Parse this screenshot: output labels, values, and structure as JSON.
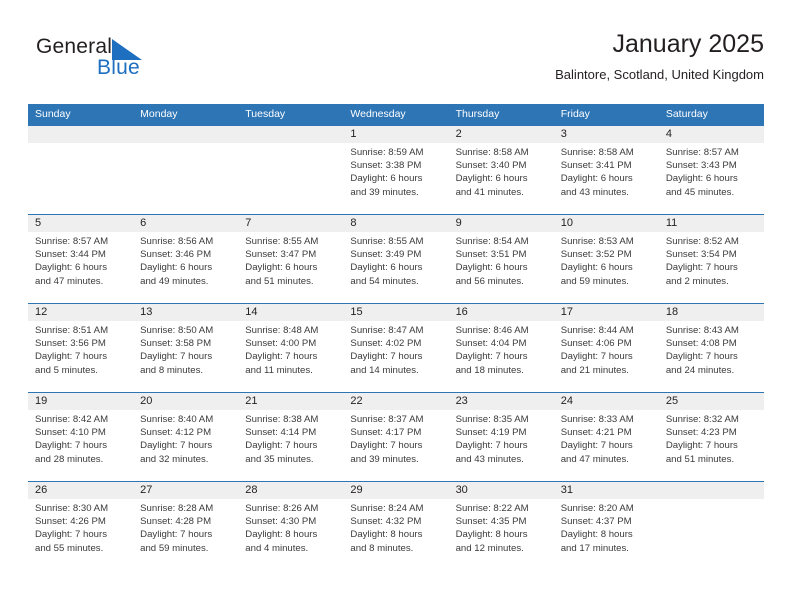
{
  "brand": {
    "word_general": "General",
    "word_blue": "Blue",
    "triangle_icon": "triangle-icon",
    "accent_color": "#1f6fc0"
  },
  "header": {
    "title": "January 2025",
    "subtitle": "Balintore, Scotland, United Kingdom",
    "header_bg_color": "#2e75b6",
    "day_band_color": "#efefef"
  },
  "weekdays": [
    "Sunday",
    "Monday",
    "Tuesday",
    "Wednesday",
    "Thursday",
    "Friday",
    "Saturday"
  ],
  "weeks": [
    [
      {
        "number": "",
        "sunrise": "",
        "sunset": "",
        "daylight_line1": "",
        "daylight_line2": ""
      },
      {
        "number": "",
        "sunrise": "",
        "sunset": "",
        "daylight_line1": "",
        "daylight_line2": ""
      },
      {
        "number": "",
        "sunrise": "",
        "sunset": "",
        "daylight_line1": "",
        "daylight_line2": ""
      },
      {
        "number": "1",
        "sunrise": "Sunrise: 8:59 AM",
        "sunset": "Sunset: 3:38 PM",
        "daylight_line1": "Daylight: 6 hours",
        "daylight_line2": "and 39 minutes."
      },
      {
        "number": "2",
        "sunrise": "Sunrise: 8:58 AM",
        "sunset": "Sunset: 3:40 PM",
        "daylight_line1": "Daylight: 6 hours",
        "daylight_line2": "and 41 minutes."
      },
      {
        "number": "3",
        "sunrise": "Sunrise: 8:58 AM",
        "sunset": "Sunset: 3:41 PM",
        "daylight_line1": "Daylight: 6 hours",
        "daylight_line2": "and 43 minutes."
      },
      {
        "number": "4",
        "sunrise": "Sunrise: 8:57 AM",
        "sunset": "Sunset: 3:43 PM",
        "daylight_line1": "Daylight: 6 hours",
        "daylight_line2": "and 45 minutes."
      }
    ],
    [
      {
        "number": "5",
        "sunrise": "Sunrise: 8:57 AM",
        "sunset": "Sunset: 3:44 PM",
        "daylight_line1": "Daylight: 6 hours",
        "daylight_line2": "and 47 minutes."
      },
      {
        "number": "6",
        "sunrise": "Sunrise: 8:56 AM",
        "sunset": "Sunset: 3:46 PM",
        "daylight_line1": "Daylight: 6 hours",
        "daylight_line2": "and 49 minutes."
      },
      {
        "number": "7",
        "sunrise": "Sunrise: 8:55 AM",
        "sunset": "Sunset: 3:47 PM",
        "daylight_line1": "Daylight: 6 hours",
        "daylight_line2": "and 51 minutes."
      },
      {
        "number": "8",
        "sunrise": "Sunrise: 8:55 AM",
        "sunset": "Sunset: 3:49 PM",
        "daylight_line1": "Daylight: 6 hours",
        "daylight_line2": "and 54 minutes."
      },
      {
        "number": "9",
        "sunrise": "Sunrise: 8:54 AM",
        "sunset": "Sunset: 3:51 PM",
        "daylight_line1": "Daylight: 6 hours",
        "daylight_line2": "and 56 minutes."
      },
      {
        "number": "10",
        "sunrise": "Sunrise: 8:53 AM",
        "sunset": "Sunset: 3:52 PM",
        "daylight_line1": "Daylight: 6 hours",
        "daylight_line2": "and 59 minutes."
      },
      {
        "number": "11",
        "sunrise": "Sunrise: 8:52 AM",
        "sunset": "Sunset: 3:54 PM",
        "daylight_line1": "Daylight: 7 hours",
        "daylight_line2": "and 2 minutes."
      }
    ],
    [
      {
        "number": "12",
        "sunrise": "Sunrise: 8:51 AM",
        "sunset": "Sunset: 3:56 PM",
        "daylight_line1": "Daylight: 7 hours",
        "daylight_line2": "and 5 minutes."
      },
      {
        "number": "13",
        "sunrise": "Sunrise: 8:50 AM",
        "sunset": "Sunset: 3:58 PM",
        "daylight_line1": "Daylight: 7 hours",
        "daylight_line2": "and 8 minutes."
      },
      {
        "number": "14",
        "sunrise": "Sunrise: 8:48 AM",
        "sunset": "Sunset: 4:00 PM",
        "daylight_line1": "Daylight: 7 hours",
        "daylight_line2": "and 11 minutes."
      },
      {
        "number": "15",
        "sunrise": "Sunrise: 8:47 AM",
        "sunset": "Sunset: 4:02 PM",
        "daylight_line1": "Daylight: 7 hours",
        "daylight_line2": "and 14 minutes."
      },
      {
        "number": "16",
        "sunrise": "Sunrise: 8:46 AM",
        "sunset": "Sunset: 4:04 PM",
        "daylight_line1": "Daylight: 7 hours",
        "daylight_line2": "and 18 minutes."
      },
      {
        "number": "17",
        "sunrise": "Sunrise: 8:44 AM",
        "sunset": "Sunset: 4:06 PM",
        "daylight_line1": "Daylight: 7 hours",
        "daylight_line2": "and 21 minutes."
      },
      {
        "number": "18",
        "sunrise": "Sunrise: 8:43 AM",
        "sunset": "Sunset: 4:08 PM",
        "daylight_line1": "Daylight: 7 hours",
        "daylight_line2": "and 24 minutes."
      }
    ],
    [
      {
        "number": "19",
        "sunrise": "Sunrise: 8:42 AM",
        "sunset": "Sunset: 4:10 PM",
        "daylight_line1": "Daylight: 7 hours",
        "daylight_line2": "and 28 minutes."
      },
      {
        "number": "20",
        "sunrise": "Sunrise: 8:40 AM",
        "sunset": "Sunset: 4:12 PM",
        "daylight_line1": "Daylight: 7 hours",
        "daylight_line2": "and 32 minutes."
      },
      {
        "number": "21",
        "sunrise": "Sunrise: 8:38 AM",
        "sunset": "Sunset: 4:14 PM",
        "daylight_line1": "Daylight: 7 hours",
        "daylight_line2": "and 35 minutes."
      },
      {
        "number": "22",
        "sunrise": "Sunrise: 8:37 AM",
        "sunset": "Sunset: 4:17 PM",
        "daylight_line1": "Daylight: 7 hours",
        "daylight_line2": "and 39 minutes."
      },
      {
        "number": "23",
        "sunrise": "Sunrise: 8:35 AM",
        "sunset": "Sunset: 4:19 PM",
        "daylight_line1": "Daylight: 7 hours",
        "daylight_line2": "and 43 minutes."
      },
      {
        "number": "24",
        "sunrise": "Sunrise: 8:33 AM",
        "sunset": "Sunset: 4:21 PM",
        "daylight_line1": "Daylight: 7 hours",
        "daylight_line2": "and 47 minutes."
      },
      {
        "number": "25",
        "sunrise": "Sunrise: 8:32 AM",
        "sunset": "Sunset: 4:23 PM",
        "daylight_line1": "Daylight: 7 hours",
        "daylight_line2": "and 51 minutes."
      }
    ],
    [
      {
        "number": "26",
        "sunrise": "Sunrise: 8:30 AM",
        "sunset": "Sunset: 4:26 PM",
        "daylight_line1": "Daylight: 7 hours",
        "daylight_line2": "and 55 minutes."
      },
      {
        "number": "27",
        "sunrise": "Sunrise: 8:28 AM",
        "sunset": "Sunset: 4:28 PM",
        "daylight_line1": "Daylight: 7 hours",
        "daylight_line2": "and 59 minutes."
      },
      {
        "number": "28",
        "sunrise": "Sunrise: 8:26 AM",
        "sunset": "Sunset: 4:30 PM",
        "daylight_line1": "Daylight: 8 hours",
        "daylight_line2": "and 4 minutes."
      },
      {
        "number": "29",
        "sunrise": "Sunrise: 8:24 AM",
        "sunset": "Sunset: 4:32 PM",
        "daylight_line1": "Daylight: 8 hours",
        "daylight_line2": "and 8 minutes."
      },
      {
        "number": "30",
        "sunrise": "Sunrise: 8:22 AM",
        "sunset": "Sunset: 4:35 PM",
        "daylight_line1": "Daylight: 8 hours",
        "daylight_line2": "and 12 minutes."
      },
      {
        "number": "31",
        "sunrise": "Sunrise: 8:20 AM",
        "sunset": "Sunset: 4:37 PM",
        "daylight_line1": "Daylight: 8 hours",
        "daylight_line2": "and 17 minutes."
      },
      {
        "number": "",
        "sunrise": "",
        "sunset": "",
        "daylight_line1": "",
        "daylight_line2": ""
      }
    ]
  ]
}
